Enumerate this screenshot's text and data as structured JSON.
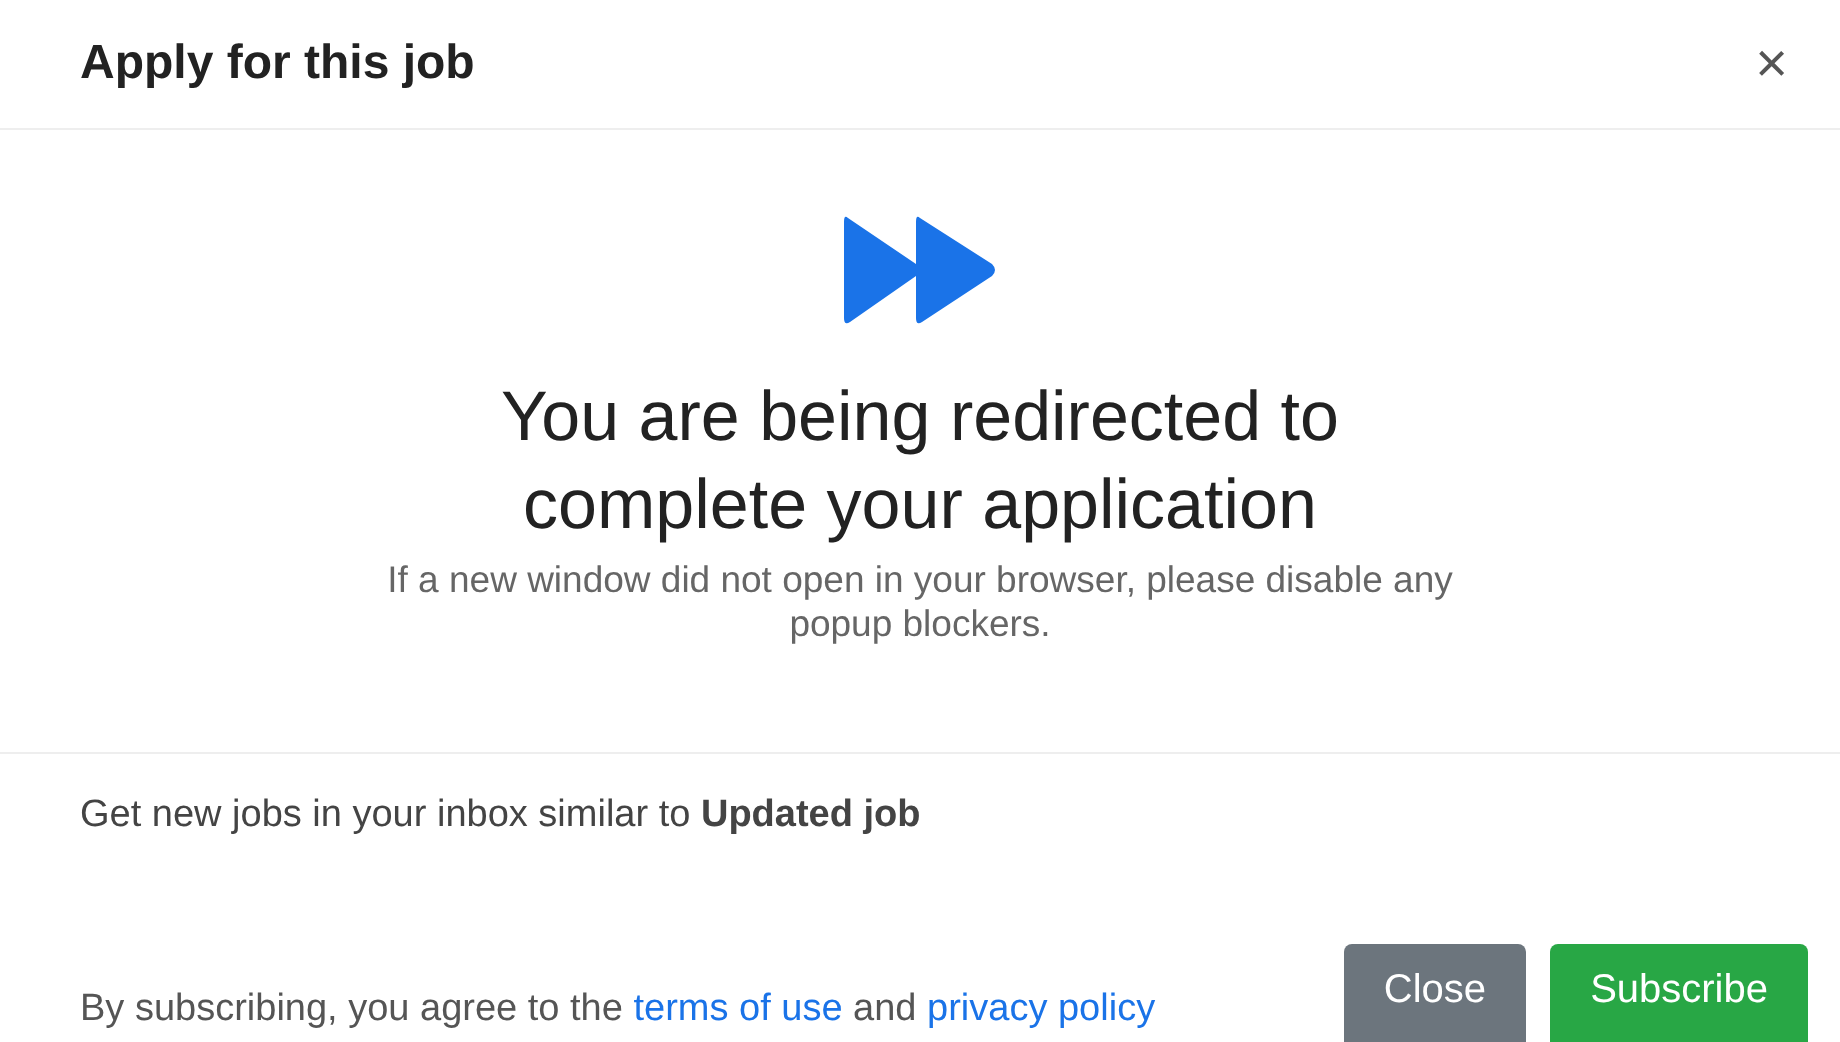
{
  "header": {
    "title": "Apply for this job",
    "close": "×"
  },
  "message": {
    "heading": "You are being redirected to complete your application",
    "note": "If a new window did not open in your browser, please disable any popup blockers."
  },
  "subscribe": {
    "text": "Get new jobs in your inbox similar to **Updated job**"
  },
  "footer": {
    "agreement": "By subscribing, you agree to the",
    "terms_link": "terms of use",
    "and": "and",
    "privacy_link": "privacy policy",
    "buttons": [
      {
        "label": "Close",
        "kind": "secondary"
      },
      {
        "label": "Subscribe",
        "kind": "primary"
      }
    ]
  }
}
